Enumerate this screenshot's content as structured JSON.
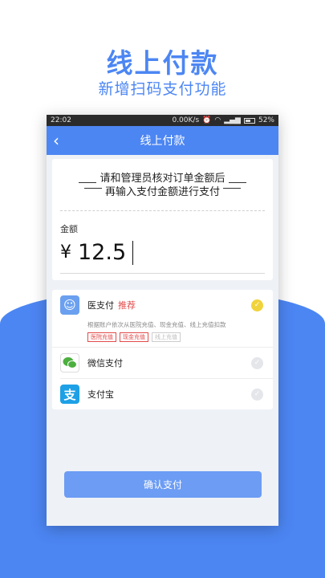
{
  "promo": {
    "title": "线上付款",
    "subtitle": "新增扫码支付功能"
  },
  "status_bar": {
    "time": "22:02",
    "network_speed": "0.00K/s",
    "battery": "52%"
  },
  "nav": {
    "title": "线上付款",
    "back_icon": "chevron-left-icon"
  },
  "notice": {
    "line1": "请和管理员核对订单金额后",
    "line2": "再输入支付金额进行支付"
  },
  "amount": {
    "label": "金额",
    "currency": "¥",
    "value": "12.5"
  },
  "methods": [
    {
      "label": "医支付",
      "badge": "推荐",
      "selected": true,
      "description": "根据账户依次从医院充值、现金充值、线上充值扣款",
      "tags": [
        "医院充值",
        "现金充值",
        "线上充值"
      ]
    },
    {
      "label": "微信支付",
      "selected": false
    },
    {
      "label": "支付宝",
      "selected": false
    }
  ],
  "confirm_button": "确认支付",
  "colors": {
    "primary": "#4c86f3",
    "button": "#6c9cf4",
    "selected_check": "#f0d33c",
    "tag_red": "#e24b4b"
  }
}
